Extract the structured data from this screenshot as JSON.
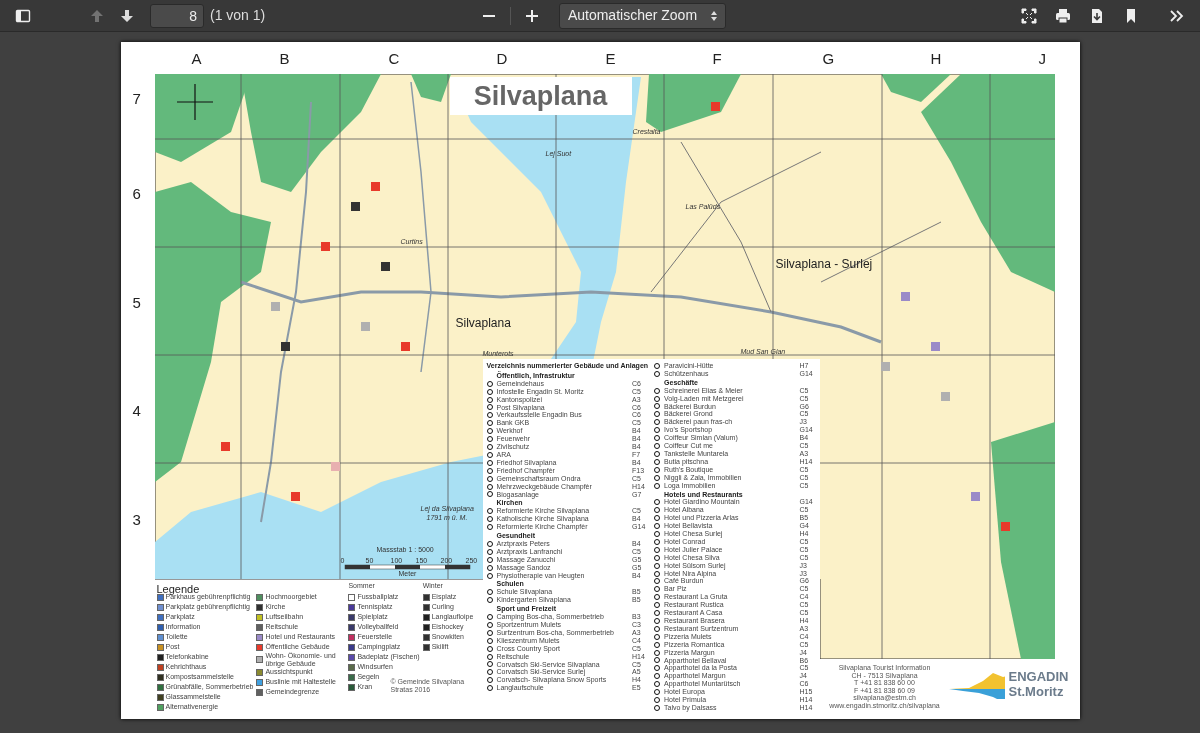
{
  "toolbar": {
    "page_nav": [
      {
        "kind": "up",
        "disabled": true
      },
      {
        "kind": "down",
        "disabled": false
      }
    ],
    "page_number": "8",
    "page_count": "(1 von 1)",
    "zoom": "Automatischer Zoom"
  },
  "map": {
    "title": "Silvaplana",
    "columns": [
      "A",
      "B",
      "C",
      "D",
      "E",
      "F",
      "G",
      "H",
      "J"
    ],
    "rows": [
      "7",
      "6",
      "5",
      "4",
      "3"
    ],
    "labels": [
      {
        "text": "Silvaplana",
        "kind": "town"
      },
      {
        "text": "Silvaplana - Surlej",
        "kind": "town"
      },
      {
        "text": "Lej Suot",
        "kind": "place"
      },
      {
        "text": "Las Palüds",
        "kind": "place"
      },
      {
        "text": "Curtins",
        "kind": "place"
      },
      {
        "text": "Crestalta",
        "kind": "place"
      },
      {
        "text": "Munterots",
        "kind": "place"
      },
      {
        "text": "Mud San Gian",
        "kind": "place"
      },
      {
        "text": "Lej da Silvaplana",
        "kind": "place"
      },
      {
        "text": "1791 m ü. M.",
        "kind": "place"
      }
    ],
    "scale": {
      "label": "Massstab 1 : 5000",
      "unit": "Meter",
      "ticks": [
        "0",
        "50",
        "100",
        "150",
        "200",
        "250"
      ]
    }
  },
  "index": {
    "title": "Verzeichnis nummerierter Gebäude und Anlagen",
    "columns": [
      [
        {
          "heading": "Öffentlich, Infrastruktur",
          "entries": [
            {
              "name": "Gemeindehaus",
              "grid": "C6"
            },
            {
              "name": "Infostelle Engadin St. Moritz",
              "grid": "C5"
            },
            {
              "name": "Kantonspolizei",
              "grid": "A3"
            },
            {
              "name": "Post Silvaplana",
              "grid": "C6"
            },
            {
              "name": "Verkaufsstelle Engadin Bus",
              "grid": "C6"
            },
            {
              "name": "Bank GKB",
              "grid": "C5"
            },
            {
              "name": "Werkhof",
              "grid": "B4"
            },
            {
              "name": "Feuerwehr",
              "grid": "B4"
            },
            {
              "name": "Zivilschutz",
              "grid": "B4"
            },
            {
              "name": "ARA",
              "grid": "F7"
            },
            {
              "name": "Friedhof Silvaplana",
              "grid": "B4"
            },
            {
              "name": "Friedhof Champfèr",
              "grid": "F13"
            },
            {
              "name": "Gemeinschaftsraum Ondra",
              "grid": "C5"
            },
            {
              "name": "Mehrzweckgebäude Champfèr",
              "grid": "H14"
            },
            {
              "name": "Biogasanlage",
              "grid": "G7"
            }
          ]
        },
        {
          "heading": "Kirchen",
          "entries": [
            {
              "name": "Reformierte Kirche Silvaplana",
              "grid": "C5"
            },
            {
              "name": "Katholische Kirche Silvaplana",
              "grid": "B4"
            },
            {
              "name": "Reformierte Kirche Champfèr",
              "grid": "G14"
            }
          ]
        },
        {
          "heading": "Gesundheit",
          "entries": [
            {
              "name": "Arztpraxis Peters",
              "grid": "B4"
            },
            {
              "name": "Arztpraxis Lanfranchi",
              "grid": "C5"
            },
            {
              "name": "Massage Zanucchi",
              "grid": "G5"
            },
            {
              "name": "Massage Sandoz",
              "grid": "G5"
            },
            {
              "name": "Physiotherapie van Heugten",
              "grid": "B4"
            }
          ]
        },
        {
          "heading": "Schulen",
          "entries": [
            {
              "name": "Schule Silvaplana",
              "grid": "B5"
            },
            {
              "name": "Kindergarten Silvaplana",
              "grid": "B5"
            }
          ]
        },
        {
          "heading": "Sport und Freizeit",
          "entries": [
            {
              "name": "Camping Bos-cha, Sommerbetrieb",
              "grid": "B3"
            },
            {
              "name": "Sportzentrum Mulets",
              "grid": "C3"
            },
            {
              "name": "Surfzentrum Bos-cha, Sommerbetrieb",
              "grid": "A3"
            },
            {
              "name": "Klieszentrum Mulets",
              "grid": "C4"
            },
            {
              "name": "Cross Country Sport",
              "grid": "C5"
            },
            {
              "name": "Reitschule",
              "grid": "H14"
            },
            {
              "name": "Corvatsch Ski-Service Silvaplana",
              "grid": "C5"
            },
            {
              "name": "Corvatsch Ski-Service Surlej",
              "grid": "A5"
            },
            {
              "name": "Corvatsch- Silvaplana Snow Sports",
              "grid": "H4"
            },
            {
              "name": "Langlaufschule",
              "grid": "E5"
            }
          ]
        }
      ],
      [
        {
          "entries": [
            {
              "name": "Paravicini-Hütte",
              "grid": "H7"
            },
            {
              "name": "Schützenhaus",
              "grid": "G14"
            }
          ]
        },
        {
          "heading": "Geschäfte",
          "entries": [
            {
              "name": "Schreinerei Elias & Meier",
              "grid": "C5"
            },
            {
              "name": "Volg-Laden mit Metzgerei",
              "grid": "C5"
            },
            {
              "name": "Bäckerei Burdun",
              "grid": "G6"
            },
            {
              "name": "Bäckerei Grond",
              "grid": "C5"
            },
            {
              "name": "Bäckerei paun fras-ch",
              "grid": "J3"
            },
            {
              "name": "Ivo's Sportshop",
              "grid": "G14"
            },
            {
              "name": "Coiffeur Simlan (Valum)",
              "grid": "B4"
            },
            {
              "name": "Coiffeur Cut me",
              "grid": "C5"
            },
            {
              "name": "Tankstelle Muntarela",
              "grid": "A3"
            },
            {
              "name": "Butia pitschna",
              "grid": "H14"
            },
            {
              "name": "Ruth's Boutique",
              "grid": "C5"
            },
            {
              "name": "Niggli & Zala, Immobilien",
              "grid": "C5"
            },
            {
              "name": "Loga Immobilien",
              "grid": "C5"
            }
          ]
        },
        {
          "heading": "Hotels und Restaurants",
          "entries": [
            {
              "name": "Hotel Giardino Mountain",
              "grid": "G14"
            },
            {
              "name": "Hotel Albana",
              "grid": "C5"
            },
            {
              "name": "Hotel und Pizzeria Arlas",
              "grid": "B5"
            },
            {
              "name": "Hotel Bellavista",
              "grid": "G4"
            },
            {
              "name": "Hotel Chesa Surlej",
              "grid": "H4"
            },
            {
              "name": "Hotel Conrad",
              "grid": "C5"
            },
            {
              "name": "Hotel Julier Palace",
              "grid": "C5"
            },
            {
              "name": "Hotel Chesa Silva",
              "grid": "C5"
            },
            {
              "name": "Hotel Sülsom Surlej",
              "grid": "J3"
            },
            {
              "name": "Hotel Nira Alpina",
              "grid": "J3"
            },
            {
              "name": "Café Burdun",
              "grid": "G6"
            },
            {
              "name": "Bar Piz",
              "grid": "C5"
            },
            {
              "name": "Restaurant La Gruta",
              "grid": "C4"
            },
            {
              "name": "Restaurant Rustica",
              "grid": "C5"
            },
            {
              "name": "Restaurant A Casa",
              "grid": "C5"
            },
            {
              "name": "Restaurant Brasera",
              "grid": "H4"
            },
            {
              "name": "Restaurant Surfzentrum",
              "grid": "A3"
            },
            {
              "name": "Pizzeria Mulets",
              "grid": "C4"
            },
            {
              "name": "Pizzeria Romantica",
              "grid": "C5"
            },
            {
              "name": "Pizzeria Margun",
              "grid": "J4"
            },
            {
              "name": "Apparthotel Bellaval",
              "grid": "B6"
            },
            {
              "name": "Apparthotel da la Posta",
              "grid": "C5"
            },
            {
              "name": "Apparthotel Margun",
              "grid": "J4"
            },
            {
              "name": "Apparthotel Muntarütsch",
              "grid": "C6"
            },
            {
              "name": "Hotel Europa",
              "grid": "H15"
            },
            {
              "name": "Hotel Primula",
              "grid": "H14"
            },
            {
              "name": "Talvo by Dalsass",
              "grid": "H14"
            }
          ]
        }
      ]
    ]
  },
  "legend": {
    "columns": [
      {
        "heading": "Legende",
        "items": [
          {
            "text": "Parkhaus gebührenpflichtig",
            "color": "#3f6fc0"
          },
          {
            "text": "Parkplatz gebührenpflichtig",
            "color": "#6f8fd0"
          },
          {
            "text": "Parkplatz",
            "color": "#3f6fc0"
          },
          {
            "text": "Information",
            "color": "#2f5fb0"
          },
          {
            "text": "Toilette",
            "color": "#5f8fd0"
          },
          {
            "text": "Post",
            "color": "#c89020"
          },
          {
            "text": "Telefonkabine",
            "color": "#202020"
          },
          {
            "text": "Kehrichthaus",
            "color": "#c04020"
          },
          {
            "text": "Kompostsammelstelle",
            "color": "#303020"
          },
          {
            "text": "Grünabfälle, Sommerbetrieb",
            "color": "#2f6f3f"
          },
          {
            "text": "Glassammelstelle",
            "color": "#404020"
          },
          {
            "text": "Alternativenergie",
            "color": "#4fa060"
          }
        ]
      },
      {
        "items": [
          {
            "text": "Hochmoorgebiet",
            "color": "#4f8f5f"
          },
          {
            "text": "Kirche",
            "color": "#303030"
          },
          {
            "text": "Luftseilbahn",
            "color": "#c0c020"
          },
          {
            "text": "Reitschule",
            "color": "#606060"
          },
          {
            "text": "Hotel und Restaurants",
            "color": "#9a8ac8"
          },
          {
            "text": "Öffentliche Gebäude",
            "color": "#e83a2a"
          },
          {
            "text": "Wohn- Ökonomie- und übrige Gebäude",
            "color": "#b0b0b0"
          },
          {
            "text": "Aussichtspunkt",
            "color": "#8a8a30"
          },
          {
            "text": "Buslinie mit Haltestelle",
            "color": "#40a0e0"
          },
          {
            "text": "Gemeindegrenze",
            "color": "#606060"
          }
        ]
      },
      {
        "heading": "Sommer",
        "items": [
          {
            "text": "Fussballplatz",
            "color": "#ffffff"
          },
          {
            "text": "Tennisplatz",
            "color": "#4a3a9a"
          },
          {
            "text": "Spielplatz",
            "color": "#3a3a6a"
          },
          {
            "text": "Volleyballfeld",
            "color": "#3a3a6a"
          },
          {
            "text": "Feuerstelle",
            "color": "#c03060"
          },
          {
            "text": "Campingplatz",
            "color": "#3a3a8a"
          },
          {
            "text": "Badeplatz (Fischen)",
            "color": "#5a4aaa"
          },
          {
            "text": "Windsurfen",
            "color": "#5a6a4a"
          },
          {
            "text": "Segeln",
            "color": "#3a6a4a"
          },
          {
            "text": "Kran",
            "color": "#2a5a3a"
          }
        ]
      },
      {
        "heading": "Winter",
        "items": [
          {
            "text": "Eisplatz",
            "color": "#303030"
          },
          {
            "text": "Curling",
            "color": "#303030"
          },
          {
            "text": "Langlaufloipe",
            "color": "#202020"
          },
          {
            "text": "Eishockey",
            "color": "#202020"
          },
          {
            "text": "Snowkiten",
            "color": "#303030"
          },
          {
            "text": "Skilift",
            "color": "#303030"
          }
        ]
      }
    ],
    "copyright": "© Gemeinde Silvaplana Stratas 2016"
  },
  "contact": [
    "Silvaplana Tourist Information",
    "CH - 7513 Silvaplana",
    "T +41 81 838 60 00",
    "F +41 81 838 60 09",
    "silvaplana@estm.ch",
    "www.engadin.stmoritz.ch/silvaplana"
  ],
  "logo": {
    "line_1": "ENGADIN",
    "line_2": "St.Moritz"
  }
}
